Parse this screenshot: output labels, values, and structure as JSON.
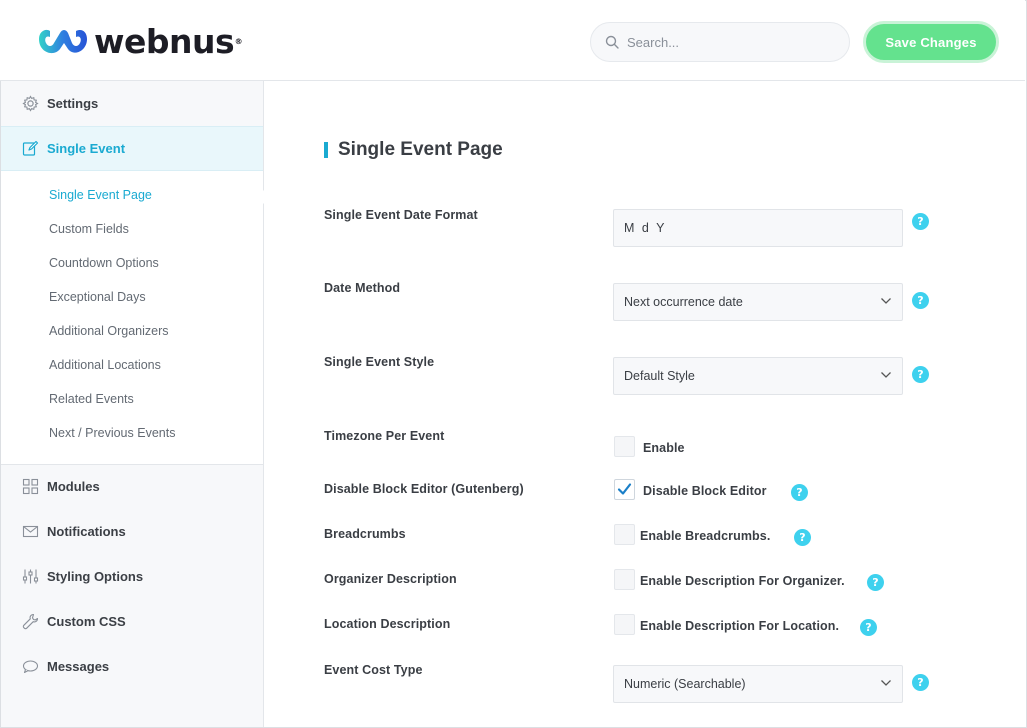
{
  "header": {
    "logo_text": "webnus",
    "logo_reg": "®",
    "search_placeholder": "Search...",
    "save_label": "Save Changes"
  },
  "sidebar": {
    "items": [
      {
        "label": "Settings",
        "icon": "gear-icon"
      },
      {
        "label": "Single Event",
        "icon": "edit-icon",
        "active": true
      },
      {
        "label": "Modules",
        "icon": "grid-icon"
      },
      {
        "label": "Notifications",
        "icon": "envelope-icon"
      },
      {
        "label": "Styling Options",
        "icon": "sliders-icon"
      },
      {
        "label": "Custom CSS",
        "icon": "wrench-icon"
      },
      {
        "label": "Messages",
        "icon": "chat-bubble-icon"
      }
    ],
    "sub_items": [
      "Single Event Page",
      "Custom Fields",
      "Countdown Options",
      "Exceptional Days",
      "Additional Organizers",
      "Additional Locations",
      "Related Events",
      "Next / Previous Events"
    ]
  },
  "main": {
    "title": "Single Event Page",
    "fields": {
      "date_format": {
        "label": "Single Event Date Format",
        "value": "M d Y"
      },
      "date_method": {
        "label": "Date Method",
        "value": "Next occurrence date"
      },
      "event_style": {
        "label": "Single Event Style",
        "value": "Default Style"
      },
      "timezone": {
        "label": "Timezone Per Event",
        "checkbox_label": "Enable",
        "checked": false
      },
      "block_editor": {
        "label": "Disable Block Editor (Gutenberg)",
        "checkbox_label": "Disable Block Editor",
        "checked": true
      },
      "breadcrumbs": {
        "label": "Breadcrumbs",
        "checkbox_label": "Enable Breadcrumbs.",
        "checked": false
      },
      "organizer_desc": {
        "label": "Organizer Description",
        "checkbox_label": "Enable Description For Organizer.",
        "checked": false
      },
      "location_desc": {
        "label": "Location Description",
        "checkbox_label": "Enable Description For Location.",
        "checked": false
      },
      "cost_type": {
        "label": "Event Cost Type",
        "value": "Numeric (Searchable)"
      }
    },
    "help_glyph": "?"
  },
  "colors": {
    "accent": "#1aaad1",
    "help": "#3ed1ee",
    "save": "#64e28e"
  }
}
